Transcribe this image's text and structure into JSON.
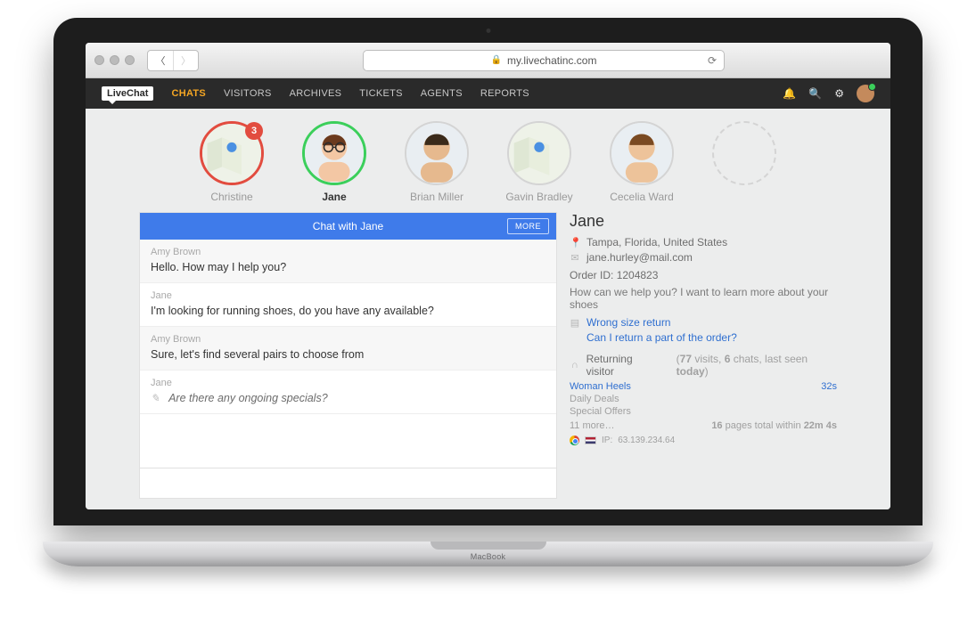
{
  "browser": {
    "url": "my.livechatinc.com"
  },
  "header": {
    "logo": "LiveChat",
    "nav": [
      "CHATS",
      "VISITORS",
      "ARCHIVES",
      "TICKETS",
      "AGENTS",
      "REPORTS"
    ],
    "active_nav_index": 0
  },
  "contacts": [
    {
      "name": "Christine",
      "ring": "red",
      "badge": "3",
      "type": "map"
    },
    {
      "name": "Jane",
      "ring": "green",
      "selected": true,
      "type": "photo-f1"
    },
    {
      "name": "Brian Miller",
      "ring": "plain",
      "type": "photo-m1"
    },
    {
      "name": "Gavin Bradley",
      "ring": "plain",
      "type": "map2"
    },
    {
      "name": "Cecelia Ward",
      "ring": "plain",
      "type": "photo-f2"
    },
    {
      "name": "",
      "ring": "dashed",
      "type": "empty"
    }
  ],
  "chat": {
    "title_prefix": "Chat with ",
    "title_name": "Jane",
    "more_label": "MORE",
    "messages": [
      {
        "sender": "Amy Brown",
        "text": "Hello. How may I help you?",
        "alt": true
      },
      {
        "sender": "Jane",
        "text": "I'm looking for running shoes, do you have any available?",
        "alt": false
      },
      {
        "sender": "Amy Brown",
        "text": "Sure, let's find several pairs to choose from",
        "alt": true
      },
      {
        "sender": "Jane",
        "text": "Are there any ongoing specials?",
        "alt": false,
        "typing": true
      }
    ],
    "composer_placeholder": ""
  },
  "details": {
    "name": "Jane",
    "location": "Tampa, Florida, United States",
    "email": "jane.hurley@mail.com",
    "order_label": "Order ID:",
    "order_id": "1204823",
    "help_text": "How can we help you? I want to learn more about your shoes",
    "link_primary": "Wrong size return",
    "link_secondary": "Can I return a part of the order?",
    "visitor_label": "Returning visitor",
    "visitor_stats_prefix": "(",
    "visitor_stats_visits": "77",
    "visitor_stats_visits_label": " visits, ",
    "visitor_stats_chats": "6",
    "visitor_stats_chats_label": " chats, last seen ",
    "visitor_stats_today": "today",
    "visitor_stats_suffix": ")",
    "pages": [
      {
        "label": "Woman Heels",
        "time": "32s",
        "link": true
      },
      {
        "label": "Daily Deals"
      },
      {
        "label": "Special Offers"
      }
    ],
    "more_pages": "11 more…",
    "pages_total_prefix": "",
    "pages_total_count": "16",
    "pages_total_mid": " pages total within ",
    "pages_total_time": "22m 4s",
    "ip_label": "IP:",
    "ip": "63.139.234.64"
  },
  "macbook_label": "MacBook"
}
